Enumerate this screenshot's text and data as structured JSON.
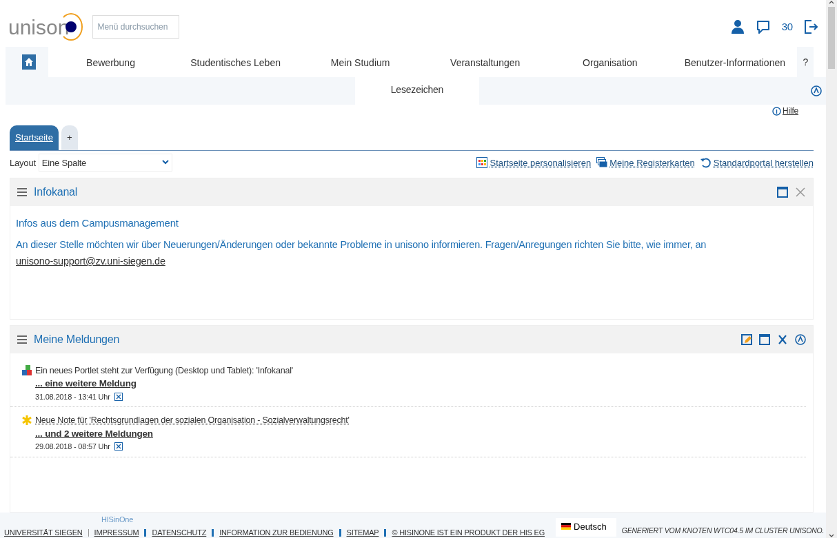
{
  "header": {
    "logo_text": "unison",
    "search": {
      "placeholder": "Menü durchsuchen"
    },
    "message_count": "30"
  },
  "nav": {
    "items": [
      {
        "label": "Bewerbung",
        "selected": false
      },
      {
        "label": "Studentisches Leben",
        "selected": false
      },
      {
        "label": "Mein Studium",
        "selected": false
      },
      {
        "label": "Veranstaltungen",
        "selected": false
      },
      {
        "label": "Organisation",
        "selected": false
      },
      {
        "label": "Benutzer-Informationen",
        "selected": false
      }
    ],
    "help": "?",
    "bookmarks": "Lesezeichen"
  },
  "help_link": "Hilfe",
  "tabs": [
    {
      "label": "Startseite",
      "selected": true
    },
    {
      "label": "+",
      "selected": false
    }
  ],
  "layout": {
    "label": "Layout",
    "value": "Eine Spalte"
  },
  "actions": [
    {
      "kind": "grid",
      "label": "Startseite personalisieren"
    },
    {
      "kind": "cards",
      "label": "Meine Registerkarten"
    },
    {
      "kind": "reset",
      "label": "Standardportal herstellen"
    }
  ],
  "portlets": [
    {
      "kind": "info",
      "title": "Infokanal",
      "heading": "Infos aus dem Campusmanagement",
      "text": "An dieser Stelle möchten wir über Neuerungen/Änderungen oder bekannte Probleme in unisono informieren. Fragen/Anregungen richten Sie bitte, wie immer, an ",
      "link": "unisono-support@zv.uni-siegen.de"
    },
    {
      "kind": "messages",
      "title": "Meine Meldungen",
      "messages": [
        {
          "kind": "portlet",
          "text": "Ein neues Portlet steht zur Verfügung (Desktop und Tablet): 'Infokanal'",
          "linked": false,
          "more": "... eine weitere Meldung",
          "date": "31.08.2018 - 13:41 Uhr"
        },
        {
          "kind": "grade",
          "text": "Neue Note für 'Rechtsgrundlagen der sozialen Organisation - Sozialverwaltungsrecht'",
          "linked": true,
          "more": "... und 2 weitere Meldungen",
          "date": "29.08.2018 - 08:57 Uhr"
        }
      ]
    }
  ],
  "footer": {
    "brand": "HISinOne",
    "links": [
      "UNIVERSITÄT SIEGEN",
      "IMPRESSUM",
      "DATENSCHUTZ",
      "INFORMATION ZUR BEDIENUNG",
      "SITEMAP",
      "© HISINONE IST EIN PRODUKT DER HIS EG"
    ],
    "language": "Deutsch",
    "generated": "GENERIERT VOM KNOTEN WTC04.5 IM CLUSTER UNISONO."
  }
}
